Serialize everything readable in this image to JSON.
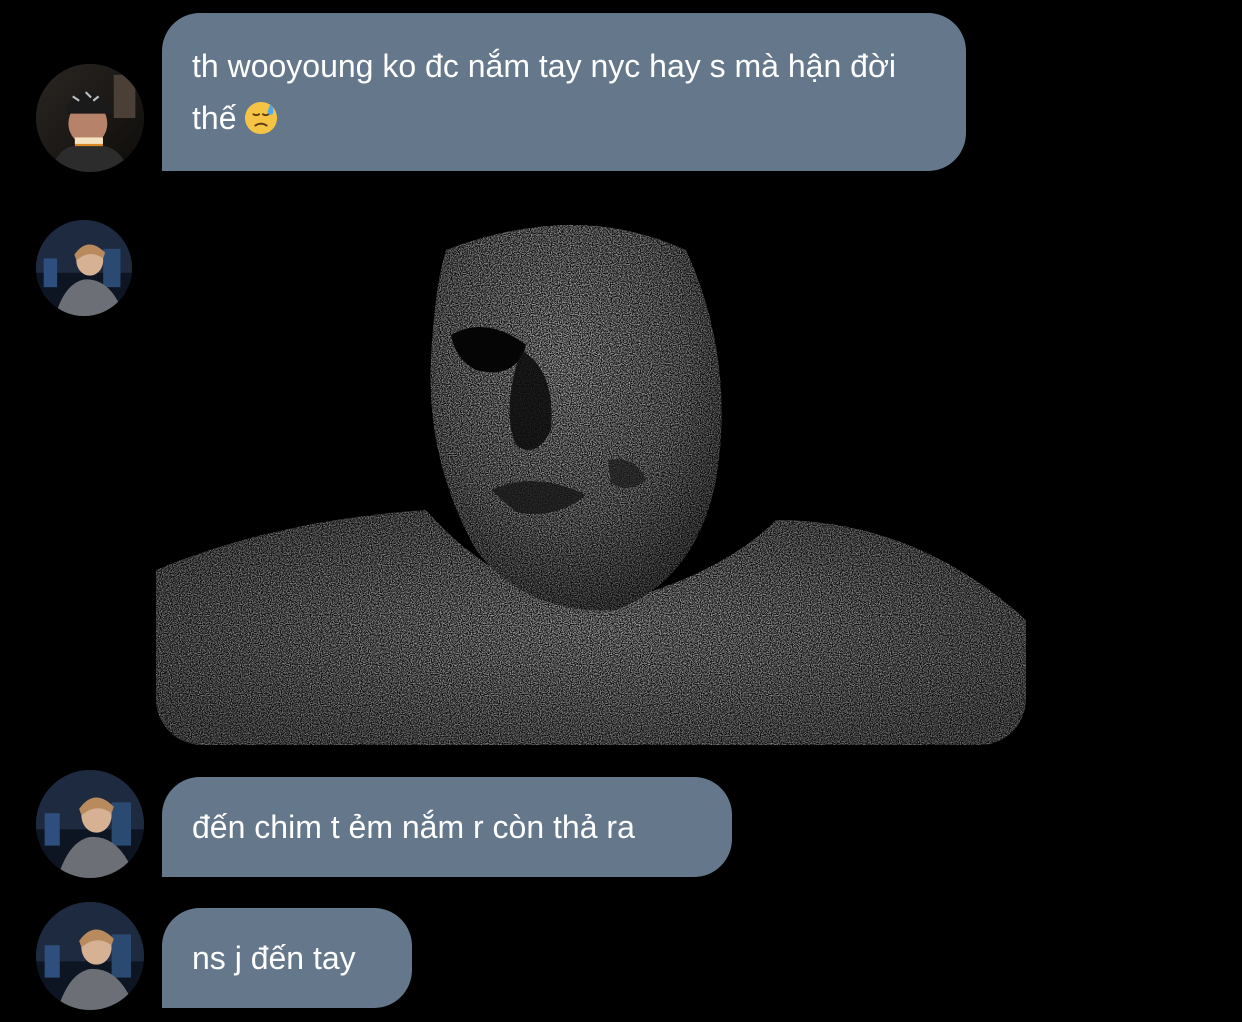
{
  "conversation": {
    "messages": [
      {
        "type": "text",
        "avatar": "avatar-person-beanie-beer",
        "text": "th wooyoung ko đc nắm tay nyc hay s mà hận đời thế",
        "emoji": "downcast-face-with-sweat-emoji"
      },
      {
        "type": "image",
        "avatar": "avatar-person-jacket-night",
        "image": "grainy-black-and-white-face-meme-photo"
      },
      {
        "type": "text",
        "avatar": "avatar-person-jacket-night",
        "text": "đến chim t ẻm nắm r còn thả ra"
      },
      {
        "type": "text",
        "avatar": "avatar-person-jacket-night",
        "text": "ns j đến tay"
      }
    ]
  },
  "colors": {
    "background": "#000000",
    "bubble": "#65788b",
    "bubble_text": "#ffffff"
  }
}
